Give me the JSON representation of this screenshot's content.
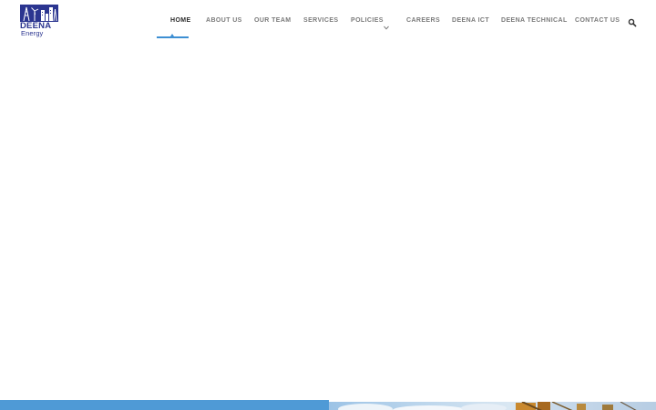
{
  "logo": {
    "name": "DEENA",
    "tagline": "Energy",
    "brand_color": "#2b3590"
  },
  "nav": {
    "items": [
      {
        "label": "HOME",
        "active": true
      },
      {
        "label": "ABOUT US"
      },
      {
        "label": "OUR TEAM"
      },
      {
        "label": "SERVICES"
      },
      {
        "label": "POLICIES",
        "has_dropdown": true
      },
      {
        "label": "CAREERS"
      },
      {
        "label": "DEENA ICT"
      },
      {
        "label": "DEENA TECHNICAL"
      },
      {
        "label": "CONTACT US"
      }
    ],
    "active_color": "#3d8fd3",
    "search_icon": "search-icon",
    "dropdown_icon": "chevron-down-icon"
  },
  "hero": {
    "left_color": "#4f9ad6"
  }
}
